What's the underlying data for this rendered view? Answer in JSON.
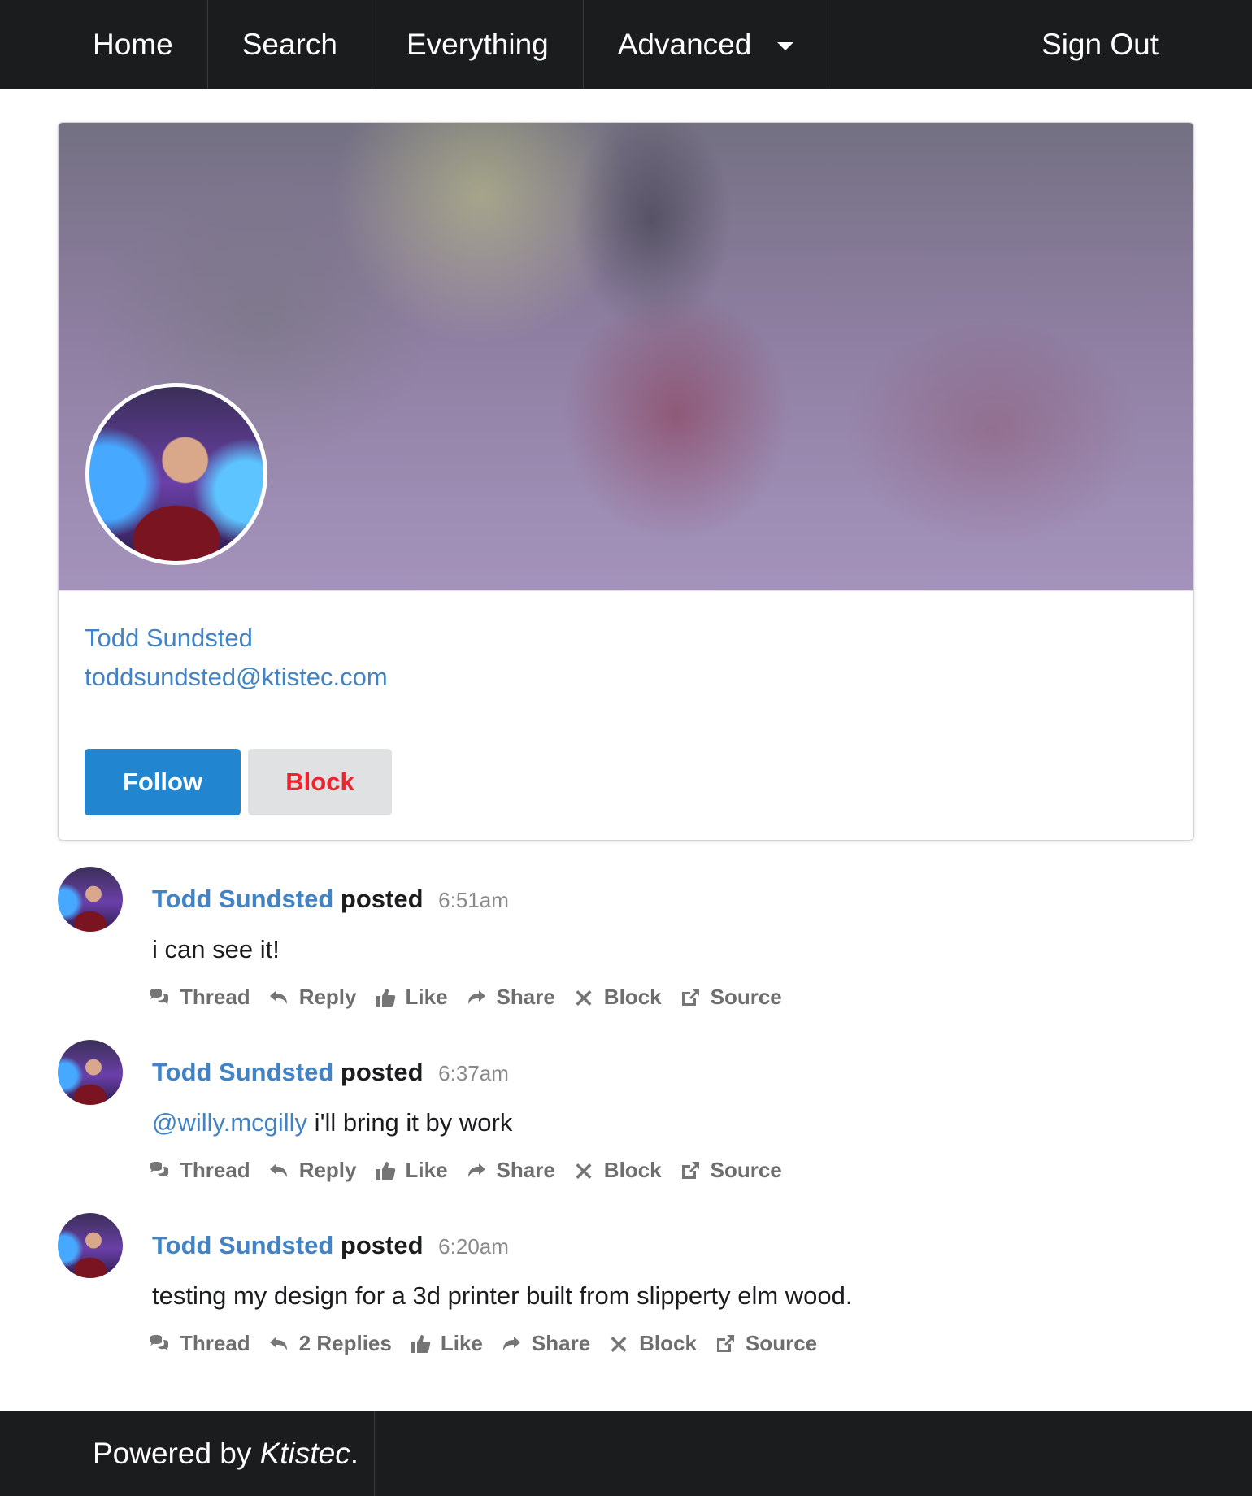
{
  "nav": {
    "items": [
      {
        "label": "Home"
      },
      {
        "label": "Search"
      },
      {
        "label": "Everything"
      },
      {
        "label": "Advanced"
      }
    ],
    "sign_out": "Sign Out"
  },
  "profile": {
    "name": "Todd Sundsted",
    "handle": "toddsundsted@ktistec.com",
    "follow_label": "Follow",
    "block_label": "Block"
  },
  "posts": [
    {
      "author": "Todd Sundsted",
      "verb": "posted",
      "time": "6:51am",
      "mention": "",
      "text": "i can see it!",
      "actions": {
        "thread": "Thread",
        "reply": "Reply",
        "like": "Like",
        "share": "Share",
        "block": "Block",
        "source": "Source"
      }
    },
    {
      "author": "Todd Sundsted",
      "verb": "posted",
      "time": "6:37am",
      "mention": "@willy.mcgilly",
      "text": " i'll bring it by work",
      "actions": {
        "thread": "Thread",
        "reply": "Reply",
        "like": "Like",
        "share": "Share",
        "block": "Block",
        "source": "Source"
      }
    },
    {
      "author": "Todd Sundsted",
      "verb": "posted",
      "time": "6:20am",
      "mention": "",
      "text": "testing my design for a 3d printer built from slipperty elm wood.",
      "actions": {
        "thread": "Thread",
        "reply": "2 Replies",
        "like": "Like",
        "share": "Share",
        "block": "Block",
        "source": "Source"
      }
    }
  ],
  "footer": {
    "prefix": "Powered by ",
    "brand": "Ktistec",
    "suffix": "."
  }
}
